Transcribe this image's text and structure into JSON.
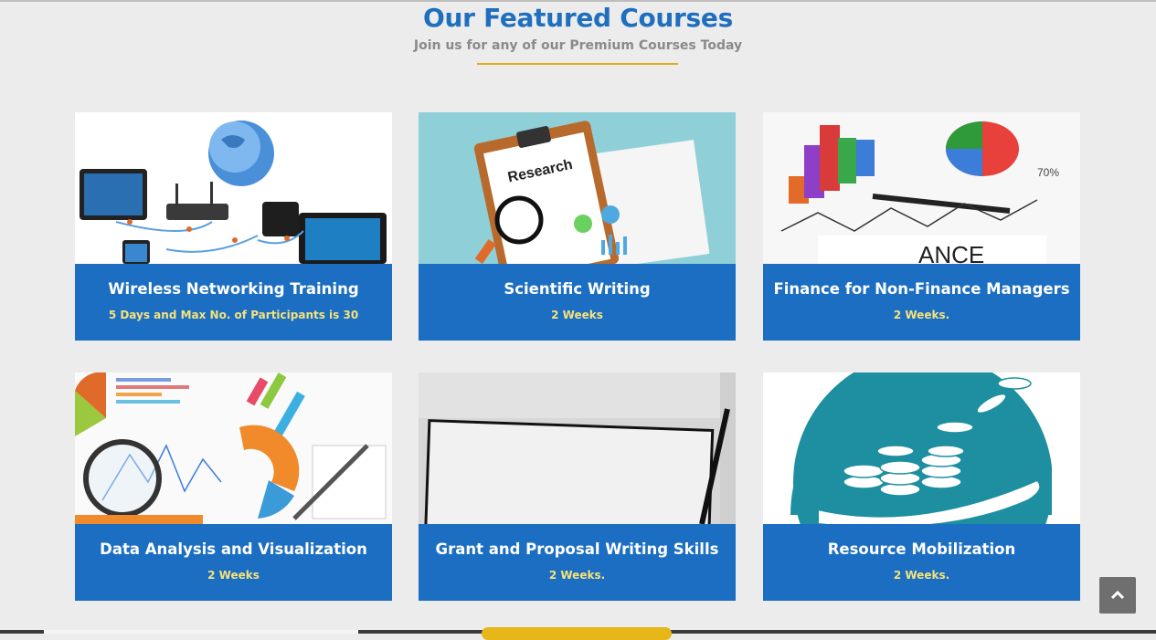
{
  "header": {
    "title": "Our Featured Courses",
    "subtitle": "Join us for any of our Premium Courses Today",
    "underline_color": "#e2ad14"
  },
  "colors": {
    "card_bg": "#1b6ec2",
    "title_text": "#ffffff",
    "duration_text": "#f6e27a",
    "heading": "#1f6fbe"
  },
  "courses": [
    {
      "title": "Wireless Networking Training",
      "duration": "5 Days and Max No. of Participants is 30",
      "image": "network-devices-image"
    },
    {
      "title": "Scientific Writing",
      "duration": "2 Weeks",
      "image": "research-clipboard-image"
    },
    {
      "title": "Finance for Non-Finance Managers",
      "duration": "2 Weeks.",
      "image": "finance-charts-image"
    },
    {
      "title": "Data Analysis and Visualization",
      "duration": "2 Weeks",
      "image": "data-charts-magnifier-image"
    },
    {
      "title": "Grant and Proposal Writing Skills",
      "duration": "2 Weeks.",
      "image": "grant-proposal-image"
    },
    {
      "title": "Resource Mobilization",
      "duration": "2 Weeks.",
      "image": "coins-hand-image"
    }
  ],
  "scroll_top": {
    "icon": "chevron-up-icon"
  }
}
